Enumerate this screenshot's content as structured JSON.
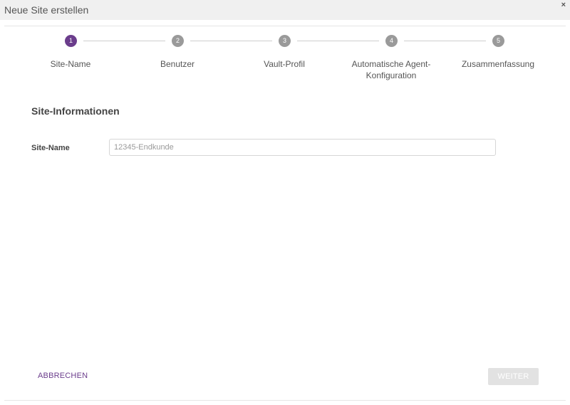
{
  "dialog": {
    "title": "Neue Site erstellen",
    "close_glyph": "×"
  },
  "stepper": {
    "active_step": 1,
    "steps": [
      {
        "number": "1",
        "label": "Site-Name"
      },
      {
        "number": "2",
        "label": "Benutzer"
      },
      {
        "number": "3",
        "label": "Vault-Profil"
      },
      {
        "number": "4",
        "label": "Automatische Agent-Konfiguration"
      },
      {
        "number": "5",
        "label": "Zusammenfassung"
      }
    ]
  },
  "form": {
    "section_title": "Site-Informationen",
    "site_name_label": "Site-Name",
    "site_name_value": "",
    "site_name_placeholder": "12345-Endkunde"
  },
  "footer": {
    "cancel_label": "ABBRECHEN",
    "next_label": "WEITER"
  },
  "colors": {
    "accent": "#6b3d8c",
    "inactive_step": "#9a9a9a",
    "disabled_button": "#e2e2e2"
  }
}
